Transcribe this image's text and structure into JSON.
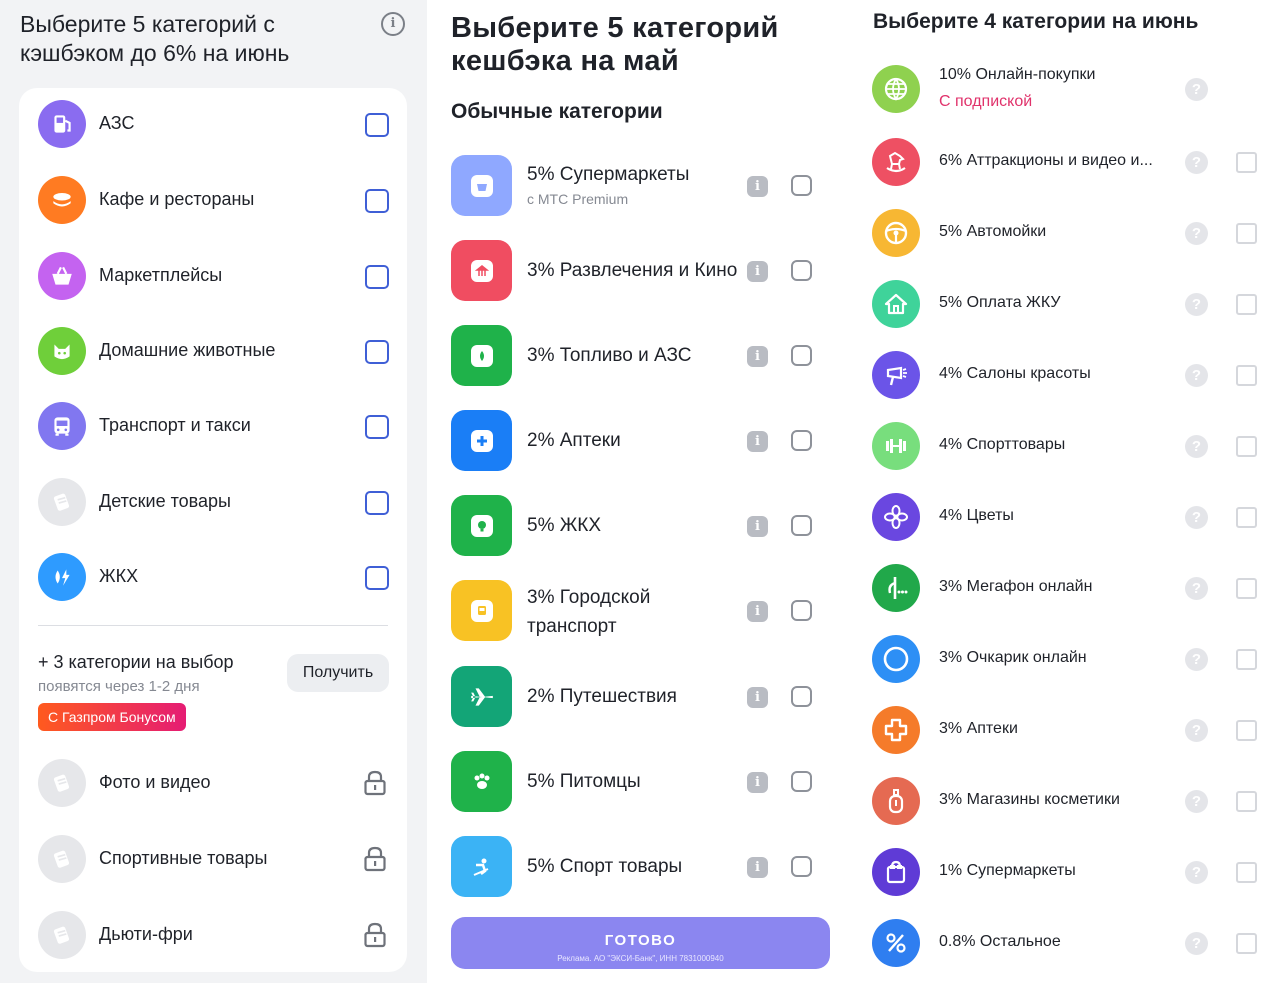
{
  "panel1": {
    "title": "Выберите 5 категорий с кэшбэком до 6% на июнь",
    "items": [
      {
        "label": "АЗС",
        "icon": "gas-station-icon",
        "color": "#8a6cf0"
      },
      {
        "label": "Кафе и рестораны",
        "icon": "cafe-icon",
        "color": "#ff7b22"
      },
      {
        "label": "Маркетплейсы",
        "icon": "shopping-basket-icon",
        "color": "#c463f0"
      },
      {
        "label": "Домашние животные",
        "icon": "cat-icon",
        "color": "#6fcf3a"
      },
      {
        "label": "Транспорт и такси",
        "icon": "bus-icon",
        "color": "#8177f0"
      },
      {
        "label": "Детские товары",
        "icon": "placeholder-icon",
        "color": "#e6e7ea"
      },
      {
        "label": "ЖКХ",
        "icon": "utilities-icon",
        "color": "#2e9bff"
      }
    ],
    "bonus": {
      "title": "+ 3 категории на выбор",
      "subtitle": "появятся через 1-2 дня",
      "badge": "С Газпром Бонусом",
      "button": "Получить"
    },
    "locked_items": [
      {
        "label": "Фото и видео",
        "icon": "placeholder-icon"
      },
      {
        "label": "Спортивные товары",
        "icon": "placeholder-icon"
      },
      {
        "label": "Дьюти-фри",
        "icon": "placeholder-icon"
      }
    ]
  },
  "panel2": {
    "title": "Выберите 5 категорий кешбэка на май",
    "subtitle": "Обычные категории",
    "items": [
      {
        "label": "5% Супермаркеты",
        "sub": "с МТС Premium",
        "icon": "basket-icon",
        "color": "#8fa8ff"
      },
      {
        "label": "3% Развлечения и Кино",
        "icon": "carousel-icon",
        "color": "#f04d61"
      },
      {
        "label": "3% Топливо и АЗС",
        "icon": "fuel-icon",
        "color": "#1fb24a"
      },
      {
        "label": "2% Аптеки",
        "icon": "medical-cross-icon",
        "color": "#1a7ef6"
      },
      {
        "label": "5% ЖКХ",
        "icon": "lightbulb-icon",
        "color": "#1fb24a"
      },
      {
        "label": "3% Городской транспорт",
        "icon": "bus-icon",
        "color": "#f8c224"
      },
      {
        "label": "2% Путешествия",
        "icon": "airplane-icon",
        "color": "#13a577"
      },
      {
        "label": "5% Питомцы",
        "icon": "paw-icon",
        "color": "#1fb24a"
      },
      {
        "label": "5% Спорт товары",
        "icon": "skier-icon",
        "color": "#3bb3f5"
      }
    ],
    "done_button": "ГОТОВО",
    "ad_text": "Реклама. АО \"ЭКСИ-Банк\", ИНН 7831000940"
  },
  "panel3": {
    "title": "Выберите 4 категории на июнь",
    "items": [
      {
        "label": "10% Онлайн-покупки",
        "sub": "С подпиской",
        "icon": "globe-icon",
        "color": "#8fd14f",
        "checkbox": false
      },
      {
        "label": "6% Аттракционы и видео и...",
        "icon": "rocking-horse-icon",
        "color": "#ee5063",
        "checkbox": true
      },
      {
        "label": "5% Автомойки",
        "icon": "steering-wheel-icon",
        "color": "#f7b733",
        "checkbox": true
      },
      {
        "label": "5% Оплата ЖКУ",
        "icon": "house-icon",
        "color": "#3fd39a",
        "checkbox": true
      },
      {
        "label": "4% Салоны красоты",
        "icon": "hair-dryer-icon",
        "color": "#6b54e8",
        "checkbox": true
      },
      {
        "label": "4% Спорттовары",
        "icon": "dumbbell-icon",
        "color": "#78de7d",
        "checkbox": true
      },
      {
        "label": "4% Цветы",
        "icon": "flower-icon",
        "color": "#6a47e0",
        "checkbox": true
      },
      {
        "label": "3% Мегафон онлайн",
        "icon": "megafon-icon",
        "color": "#21a84a",
        "checkbox": true
      },
      {
        "label": "3% Очкарик онлайн",
        "icon": "circle-icon",
        "color": "#2d8ff5",
        "checkbox": true
      },
      {
        "label": "3% Аптеки",
        "icon": "pharmacy-cross-icon",
        "color": "#f57b2a",
        "checkbox": true
      },
      {
        "label": "3% Магазины косметики",
        "icon": "perfume-icon",
        "color": "#e56a52",
        "checkbox": true
      },
      {
        "label": "1% Супермаркеты",
        "icon": "shopping-bag-icon",
        "color": "#5f3bd6",
        "checkbox": true
      },
      {
        "label": "0.8% Остальное",
        "icon": "percent-icon",
        "color": "#2f7ef0",
        "checkbox": true
      }
    ]
  }
}
